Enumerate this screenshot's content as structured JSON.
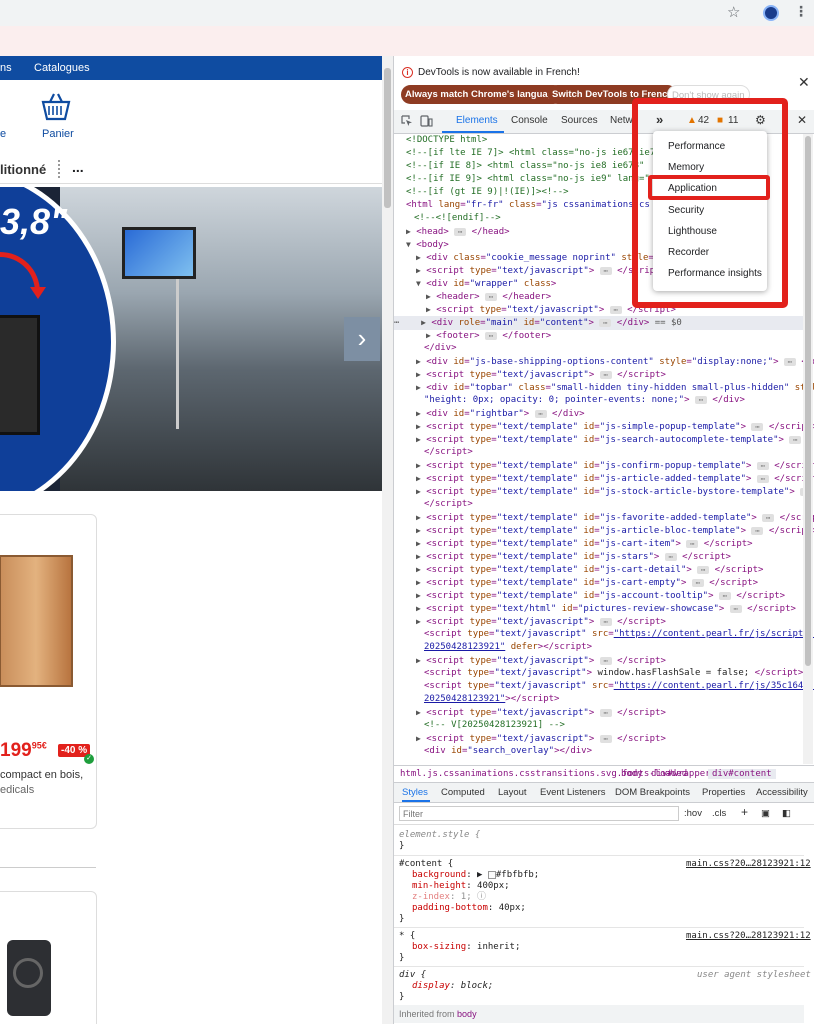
{
  "browser": {
    "star_icon": "☆",
    "menu_icon": "⋮"
  },
  "site": {
    "nav": {
      "item1": "ns",
      "item2": "Catalogues"
    },
    "basket_label": "Panier",
    "left_letter": "e",
    "filter_text": "litionné",
    "filter_more": "...",
    "banner_text": "3,8\"",
    "next_icon": "›",
    "product1": {
      "price": "199",
      "cents": "95€",
      "discount": "-40 %",
      "desc": "compact en bois,",
      "desc2": "edicals"
    }
  },
  "devtools": {
    "notice": {
      "message": "DevTools is now available in French!",
      "btn1": "Always match Chrome's language",
      "btn2": "Switch DevTools to French",
      "btn3": "Don't show again",
      "close": "✕"
    },
    "tabs": {
      "elements": "Elements",
      "console": "Console",
      "sources": "Sources",
      "network": "Netwo",
      "more": "»",
      "warnings": "42",
      "errors": "11",
      "gear": "⚙",
      "close": "✕"
    },
    "menu": {
      "items": [
        "Performance",
        "Memory",
        "Application",
        "Security",
        "Lighthouse",
        "Recorder",
        "Performance insights"
      ]
    },
    "breadcrumbs": [
      "html.js.cssanimations.csstransitions.svg.fonts-loaded",
      "body",
      "div#wrapper",
      "div#content"
    ],
    "subtabs": [
      "Styles",
      "Computed",
      "Layout",
      "Event Listeners",
      "DOM Breakpoints",
      "Properties",
      "Accessibility"
    ],
    "filter": {
      "placeholder": "Filter",
      "hov": ":hov",
      "cls": ".cls",
      "plus": "+"
    },
    "styles": {
      "element_style": "element.style {",
      "content_sel": "#content {",
      "content_src": "main.css?20…28123921:12",
      "bg_prop": "background",
      "bg_val": "#fbfbfb;",
      "minh_prop": "min-height",
      "minh_val": "400px;",
      "z_prop": "z-index",
      "z_val": "1;",
      "pb_prop": "padding-bottom",
      "pb_val": "40px;",
      "star_sel": "* {",
      "star_src": "main.css?20…28123921:12",
      "bs_prop": "box-sizing",
      "bs_val": "inherit;",
      "div_sel": "div {",
      "div_src": "user agent stylesheet",
      "disp_prop": "display",
      "disp_val": "block;",
      "close_brace": "}",
      "inherited": "Inherited from",
      "inherited_el": "body"
    }
  }
}
